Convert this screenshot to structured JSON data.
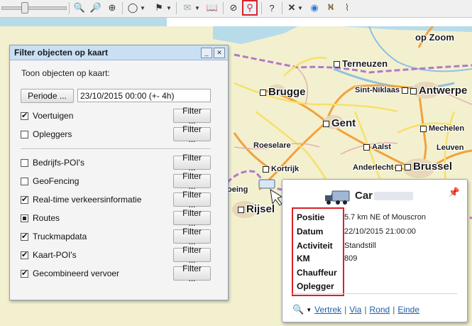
{
  "toolbar": {
    "icons": [
      "zoom-in-icon",
      "zoom-out-icon",
      "zoom-fit-icon",
      "lasso-icon",
      "checkered-flag-icon",
      "envelope-icon",
      "book-icon",
      "compass-icon",
      "filter-icon",
      "help-icon",
      "close-icon",
      "water-drop-icon",
      "road-icon",
      "broom-icon"
    ]
  },
  "map": {
    "cities": [
      {
        "name": "op Zoom"
      },
      {
        "name": "Terneuzen"
      },
      {
        "name": "Brugge"
      },
      {
        "name": "Sint-Niklaas"
      },
      {
        "name": "Antwerpe"
      },
      {
        "name": "Gent"
      },
      {
        "name": "Mechelen"
      },
      {
        "name": "Roeselare"
      },
      {
        "name": "Aalst"
      },
      {
        "name": "Leuven"
      },
      {
        "name": "Kortrijk"
      },
      {
        "name": "Anderlecht"
      },
      {
        "name": "Brussel"
      },
      {
        "name": "Rijsel"
      },
      {
        "name": "oeing"
      }
    ]
  },
  "dialog": {
    "title": "Filter objecten op kaart",
    "subtitle": "Toon objecten op kaart:",
    "period_button": "Periode ...",
    "period_value": "23/10/2015 00:00 (+- 4h)",
    "filter_label": "Filter ...",
    "items": [
      {
        "label": "Voertuigen",
        "state": "checked"
      },
      {
        "label": "Opleggers",
        "state": "unchecked"
      },
      {
        "label": "Bedrijfs-POI's",
        "state": "unchecked"
      },
      {
        "label": "GeoFencing",
        "state": "unchecked"
      },
      {
        "label": "Real-time verkeersinformatie",
        "state": "checked"
      },
      {
        "label": "Routes",
        "state": "partial"
      },
      {
        "label": "Truckmapdata",
        "state": "checked"
      },
      {
        "label": "Kaart-POI's",
        "state": "checked"
      },
      {
        "label": "Gecombineerd vervoer",
        "state": "checked"
      }
    ]
  },
  "popup": {
    "title": "Car",
    "rows": [
      {
        "label": "Positie",
        "value": "5.7 km NE of Mouscron"
      },
      {
        "label": "Datum",
        "value": "22/10/2015 21:00:00"
      },
      {
        "label": "Activiteit",
        "value": "Standstill"
      },
      {
        "label": "KM",
        "value": "809"
      },
      {
        "label": "Chauffeur",
        "value": ""
      },
      {
        "label": "Oplegger",
        "value": ""
      }
    ],
    "links": [
      "Vertrek",
      "Via",
      "Rond",
      "Einde"
    ]
  },
  "colors": {
    "highlight": "#d8222a",
    "link": "#1f5fa8",
    "map_land": "#f3f0cf",
    "water": "#b8dbe9"
  }
}
